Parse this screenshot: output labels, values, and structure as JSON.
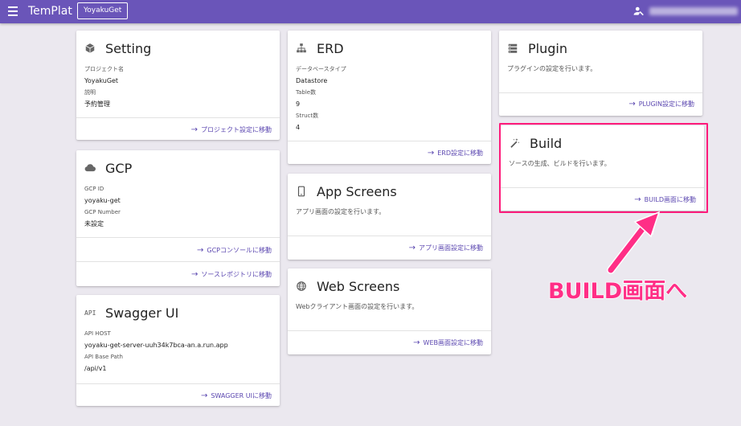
{
  "appbar": {
    "brand": "TemPlat",
    "project_button": "YoyakuGet"
  },
  "cards": {
    "setting": {
      "title": "Setting",
      "fields": [
        {
          "label": "プロジェクト名",
          "value": "YoyakuGet"
        },
        {
          "label": "説明",
          "value": "予約管理"
        }
      ],
      "action": "プロジェクト設定に移動"
    },
    "gcp": {
      "title": "GCP",
      "fields": [
        {
          "label": "GCP ID",
          "value": "yoyaku-get"
        },
        {
          "label": "GCP Number",
          "value": "未設定"
        }
      ],
      "action1": "GCPコンソールに移動",
      "action2": "ソースレポジトリに移動"
    },
    "swagger": {
      "title": "Swagger UI",
      "icon_text": "API",
      "fields": [
        {
          "label": "API HOST",
          "value": "yoyaku-get-server-uuh34k7bca-an.a.run.app"
        },
        {
          "label": "API Base Path",
          "value": "/api/v1"
        }
      ],
      "action": "SWAGGER UIに移動"
    },
    "erd": {
      "title": "ERD",
      "fields": [
        {
          "label": "データベースタイプ",
          "value": "Datastore"
        },
        {
          "label": "Table数",
          "value": "9"
        },
        {
          "label": "Struct数",
          "value": "4"
        }
      ],
      "action": "ERD設定に移動"
    },
    "app_screens": {
      "title": "App Screens",
      "desc": "アプリ画面の設定を行います。",
      "action": "アプリ画面設定に移動"
    },
    "web_screens": {
      "title": "Web Screens",
      "desc": "Webクライアント画面の設定を行います。",
      "action": "WEB画面設定に移動"
    },
    "plugin": {
      "title": "Plugin",
      "desc": "プラグインの設定を行います。",
      "action": "PLUGIN設定に移動"
    },
    "build": {
      "title": "Build",
      "desc": "ソースの生成、ビルドを行います。",
      "action": "BUILD画面に移動"
    }
  },
  "annotation": {
    "callout": "BUILD画面へ",
    "color": "#ff2e86"
  },
  "colors": {
    "appbar": "#6a55b9",
    "accent": "#5b47b0",
    "background": "#ebe8ef"
  }
}
